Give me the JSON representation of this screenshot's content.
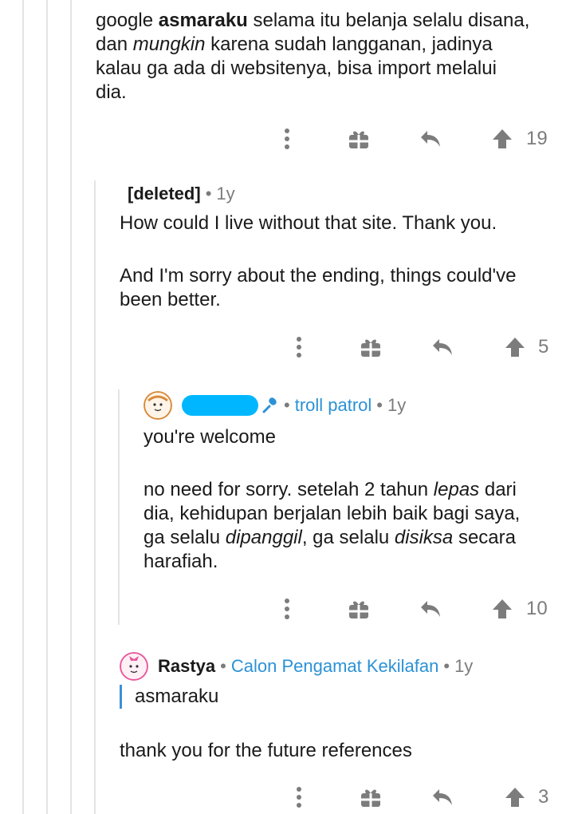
{
  "comments": [
    {
      "id": "c1",
      "body": {
        "w1": "google",
        "w2": "asmaraku",
        "w3": "selama itu belanja selalu disana,",
        "w4": "dan",
        "w5": "mungkin",
        "w6": "karena sudah langganan, jadinya",
        "w7": "kalau ga ada di websitenya, bisa import melalui",
        "w8": "dia."
      },
      "score": "19"
    },
    {
      "id": "c2",
      "author": "[deleted]",
      "age": "1y",
      "body": {
        "p1": "How could I live without that site. Thank you.",
        "p2a": "And I'm sorry about the ending, things could've",
        "p2b": "been better."
      },
      "score": "5"
    },
    {
      "id": "c3",
      "author_redacted": true,
      "badge_icon": "mic-icon",
      "flair": "troll patrol",
      "age": "1y",
      "body": {
        "p1": "you're welcome",
        "l1a": "no need for sorry. setelah 2 tahun",
        "l1b": "lepas",
        "l1c": "dari",
        "l2": "dia, kehidupan berjalan lebih baik bagi saya,",
        "l3a": "ga selalu",
        "l3b": "dipanggil",
        "l3c": ", ga selalu",
        "l3d": "disiksa",
        "l3e": "secara",
        "l4": "harafiah."
      },
      "score": "10"
    },
    {
      "id": "c4",
      "author": "Rastya",
      "flair": "Calon Pengamat Kekilafan",
      "age": "1y",
      "quote": "asmaraku",
      "body": {
        "p1": "thank you for the future references"
      },
      "score": "3"
    }
  ],
  "separator": "•",
  "icons": {
    "more": "more-vertical-icon",
    "award": "gift-award-icon",
    "reply": "reply-arrow-icon",
    "upvote": "upvote-arrow-icon"
  },
  "colors": {
    "flair": "#2b92d6",
    "muted": "#7c7c7c",
    "thread_line": "#e4e4e6",
    "quote_bar": "#3d8fd6"
  }
}
